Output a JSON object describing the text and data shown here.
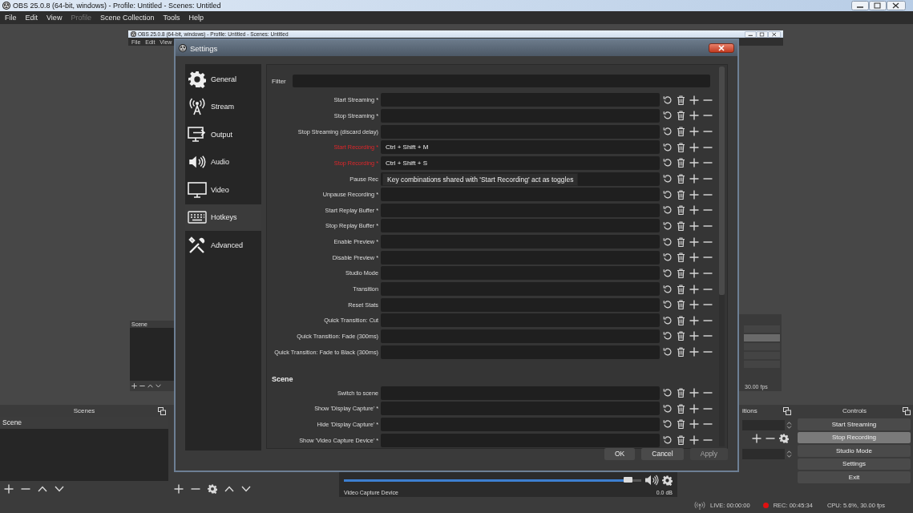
{
  "window": {
    "title": "OBS 25.0.8 (64-bit, windows) - Profile: Untitled - Scenes: Untitled"
  },
  "menu": [
    {
      "label": "File",
      "disabled": false
    },
    {
      "label": "Edit",
      "disabled": false
    },
    {
      "label": "View",
      "disabled": false
    },
    {
      "label": "Profile",
      "disabled": true
    },
    {
      "label": "Scene Collection",
      "disabled": false
    },
    {
      "label": "Tools",
      "disabled": false
    },
    {
      "label": "Help",
      "disabled": false
    }
  ],
  "inner_window": {
    "title": "OBS 25.0.8 (64-bit, windows) - Profile: Untitled - Scenes: Untitled",
    "menu": [
      "File",
      "Edit",
      "View"
    ],
    "scenes_header": "Scene",
    "status_text": "30.00 fps"
  },
  "settings": {
    "title": "Settings",
    "categories": [
      {
        "label": "General",
        "selected": false
      },
      {
        "label": "Stream",
        "selected": false
      },
      {
        "label": "Output",
        "selected": false
      },
      {
        "label": "Audio",
        "selected": false
      },
      {
        "label": "Video",
        "selected": false
      },
      {
        "label": "Hotkeys",
        "selected": true
      },
      {
        "label": "Advanced",
        "selected": false
      }
    ],
    "filter_label": "Filter",
    "hotkeys": [
      {
        "kind": "row",
        "label": "Start Streaming *",
        "conflict": false
      },
      {
        "kind": "row",
        "label": "Stop Streaming *",
        "conflict": false
      },
      {
        "kind": "row",
        "label": "Stop Streaming (discard delay)",
        "conflict": false
      },
      {
        "kind": "row",
        "label": "Start Recording *",
        "value": "Ctrl + Shift + M",
        "conflict": true
      },
      {
        "kind": "row",
        "label": "Stop Recording *",
        "value": "Ctrl + Shift + S",
        "conflict": true
      },
      {
        "kind": "row",
        "label": "Pause Rec",
        "conflict": false,
        "tooltip": "Key combinations shared with 'Start Recording' act as toggles"
      },
      {
        "kind": "row",
        "label": "Unpause Recording *",
        "conflict": false
      },
      {
        "kind": "row",
        "label": "Start Replay Buffer *",
        "conflict": false
      },
      {
        "kind": "row",
        "label": "Stop Replay Buffer *",
        "conflict": false
      },
      {
        "kind": "row",
        "label": "Enable Preview *",
        "conflict": false
      },
      {
        "kind": "row",
        "label": "Disable Preview *",
        "conflict": false
      },
      {
        "kind": "row",
        "label": "Studio Mode",
        "conflict": false
      },
      {
        "kind": "row",
        "label": "Transition",
        "conflict": false
      },
      {
        "kind": "row",
        "label": "Reset Stats",
        "conflict": false
      },
      {
        "kind": "row",
        "label": "Quick Transition: Cut",
        "conflict": false
      },
      {
        "kind": "row",
        "label": "Quick Transition: Fade (300ms)",
        "conflict": false
      },
      {
        "kind": "row",
        "label": "Quick Transition: Fade to Black (300ms)",
        "conflict": false
      },
      {
        "kind": "heading",
        "label": "Scene"
      },
      {
        "kind": "row",
        "label": "Switch to scene",
        "conflict": false
      },
      {
        "kind": "row",
        "label": "Show 'Display Capture' *",
        "conflict": false
      },
      {
        "kind": "row",
        "label": "Hide 'Display Capture' *",
        "conflict": false
      },
      {
        "kind": "row",
        "label": "Show 'Video Capture Device' *",
        "conflict": false
      }
    ],
    "buttons": [
      {
        "label": "OK",
        "disabled": false
      },
      {
        "label": "Cancel",
        "disabled": false
      },
      {
        "label": "Apply",
        "disabled": true
      }
    ]
  },
  "scenes": {
    "title": "Scenes",
    "items": [
      {
        "label": "Scene",
        "selected": true
      }
    ]
  },
  "mixer": {
    "source": "Video Capture Device",
    "reading": "0.0 dB",
    "level": 0.97
  },
  "transitions": {
    "title": "itions"
  },
  "controls": {
    "title": "Controls",
    "buttons": [
      {
        "label": "Start Streaming",
        "active": false
      },
      {
        "label": "Stop Recording",
        "active": true
      },
      {
        "label": "Studio Mode",
        "active": false
      },
      {
        "label": "Settings",
        "active": false
      },
      {
        "label": "Exit",
        "active": false
      }
    ]
  },
  "status_bar": {
    "live": "LIVE: 00:00:00",
    "rec": "REC: 00:45:34",
    "cpu": "CPU: 5.6%, 30.00 fps"
  }
}
